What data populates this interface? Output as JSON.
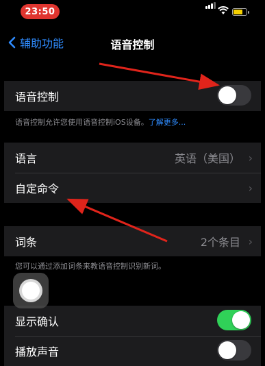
{
  "status_bar": {
    "time": "23:50"
  },
  "nav": {
    "back_label": "辅助功能",
    "title": "语音控制"
  },
  "voice_control": {
    "label": "语音控制",
    "enabled": false
  },
  "voice_control_footer": {
    "text": "语音控制允许您使用语音控制iOS设备。",
    "link": "了解更多..."
  },
  "language_group": {
    "language_label": "语言",
    "language_value": "英语（美国）",
    "custom_commands_label": "自定命令"
  },
  "vocabulary": {
    "label": "词条",
    "value": "2个条目"
  },
  "vocabulary_footer": "您可以通过添加词条来教语音控制识别新词。",
  "show_confirmation": {
    "label": "显示确认",
    "enabled": true
  },
  "play_sound": {
    "label": "播放声音",
    "enabled": false
  },
  "colors": {
    "accent": "#2f8cff",
    "toggle_on": "#30d158",
    "annotation_arrow": "#e0241b"
  }
}
